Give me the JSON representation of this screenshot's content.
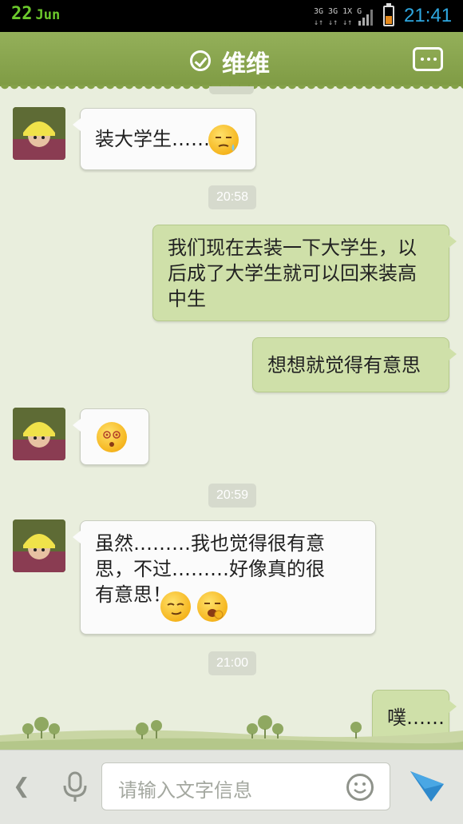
{
  "status_bar": {
    "day": "22",
    "month": "Jun",
    "network_label": "3G 3G 1X G",
    "time": "21:41",
    "battery_level": 0.45
  },
  "title_bar": {
    "title": "维维",
    "verified_icon": "check-circle-icon",
    "menu_icon": "more-dots-icon"
  },
  "messages": [
    {
      "side": "in",
      "text": "装大学生……",
      "emojis": [
        "sweat-emoji"
      ]
    },
    {
      "timestamp": "20:58"
    },
    {
      "side": "out",
      "text": "我们现在去装一下大学生，以后成了大学生就可以回来装高中生"
    },
    {
      "side": "out",
      "text": "想想就觉得有意思"
    },
    {
      "side": "in",
      "text": "",
      "emojis": [
        "dizzy-emoji"
      ]
    },
    {
      "timestamp": "20:59"
    },
    {
      "side": "in",
      "text": "虽然………我也觉得很有意思，不过………好像真的很有意思！",
      "emojis": [
        "smug-emoji",
        "yawn-emoji"
      ]
    },
    {
      "timestamp": "21:00"
    },
    {
      "side": "out",
      "text": "噗……"
    }
  ],
  "input_bar": {
    "placeholder": "请输入文字信息",
    "back_icon": "chevron-left-icon",
    "voice_icon": "microphone-icon",
    "emoji_icon": "smiley-icon",
    "send_icon": "send-icon"
  },
  "colors": {
    "title_bar": "#8ba64e",
    "outgoing_bubble": "#cfe0a9",
    "incoming_bubble": "#fbfbfb",
    "background": "#e9eedd",
    "time_accent": "#2ea7e0"
  }
}
